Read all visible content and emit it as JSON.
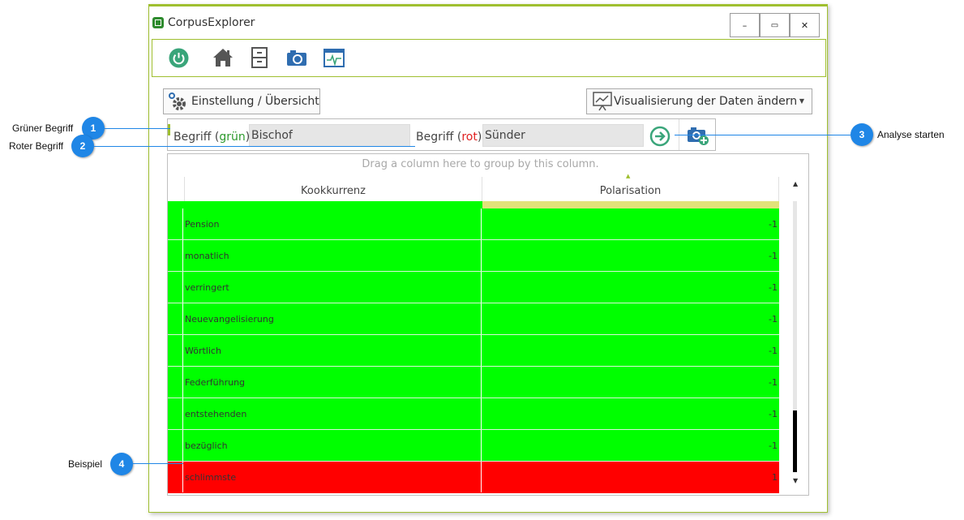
{
  "window": {
    "title": "CorpusExplorer",
    "controls": {
      "minimize": "–",
      "maximize": "▭",
      "close": "✕"
    }
  },
  "toolbar": {
    "icons": [
      "power-icon",
      "home-icon",
      "cabinet-icon",
      "camera-icon",
      "monitor-icon"
    ]
  },
  "settings_button": {
    "label": "Einstellung / Übersicht"
  },
  "visualize_button": {
    "label": "Visualisierung der Daten ändern"
  },
  "search": {
    "green_label_prefix": "Begriff (",
    "green_label_word": "grün",
    "green_label_suffix": "):",
    "green_value": "Bischof",
    "red_label_prefix": "Begriff (",
    "red_label_word": "rot",
    "red_label_suffix": "):",
    "red_value": "Sünder"
  },
  "grid": {
    "group_hint": "Drag a column here to group by this column.",
    "columns": [
      "Kookkurrenz",
      "Polarisation"
    ],
    "rows": [
      {
        "term": "Pension",
        "value": "-1",
        "polarity": "green"
      },
      {
        "term": "monatlich",
        "value": "-1",
        "polarity": "green"
      },
      {
        "term": "verringert",
        "value": "-1",
        "polarity": "green"
      },
      {
        "term": "Neuevangelisierung",
        "value": "-1",
        "polarity": "green"
      },
      {
        "term": "Wörtlich",
        "value": "-1",
        "polarity": "green"
      },
      {
        "term": "Federführung",
        "value": "-1",
        "polarity": "green"
      },
      {
        "term": "entstehenden",
        "value": "-1",
        "polarity": "green"
      },
      {
        "term": "bezüglich",
        "value": "-1",
        "polarity": "green"
      },
      {
        "term": "schlimmste",
        "value": "1",
        "polarity": "red"
      }
    ]
  },
  "callouts": [
    {
      "number": "1",
      "label": "Grüner Begriff"
    },
    {
      "number": "2",
      "label": "Roter Begriff"
    },
    {
      "number": "3",
      "label": "Analyse starten"
    },
    {
      "number": "4",
      "label": "Beispiel"
    }
  ],
  "colors": {
    "accent": "#9fbf2f",
    "row_green": "#00ff00",
    "row_red": "#ff0000",
    "callout": "#1f86e6",
    "label_green": "#2e9a2e",
    "label_red": "#e02020"
  }
}
